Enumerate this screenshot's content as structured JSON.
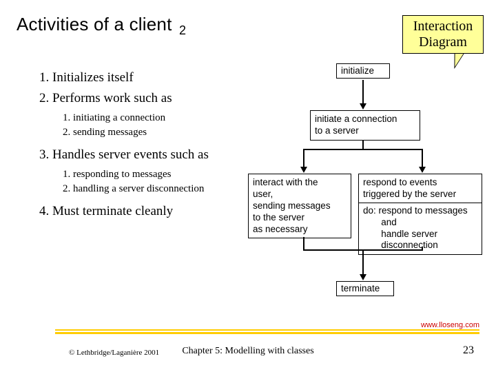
{
  "title": "Activities of a client",
  "title_sub": "2",
  "callout_l1": "Interaction",
  "callout_l2": "Diagram",
  "main": {
    "i1": "Initializes itself",
    "i2": "Performs work such as",
    "i3": "Handles server events such as",
    "i4": "Must terminate cleanly"
  },
  "sub_a": {
    "s1": "initiating a connection",
    "s2": "sending messages"
  },
  "sub_b": {
    "s1": "responding to messages",
    "s2": "handling a server disconnection"
  },
  "nodes": {
    "n1": "initialize",
    "n2_l1": "initiate a connection",
    "n2_l2": "to a server",
    "n3_l1": "interact with the",
    "n3_l2": "user,",
    "n3_l3": "sending messages",
    "n3_l4": "to the server",
    "n3_l5": "as necessary",
    "n4_l1": "respond to events",
    "n4_l2": "triggered by the server",
    "n4_l3": "do: respond to messages",
    "n4_l4": "       and",
    "n4_l5": "       handle server",
    "n4_l6": "       disconnection",
    "n5": "terminate"
  },
  "footer": {
    "url": "www.lloseng.com",
    "copy": "© Lethbridge/Laganière 2001",
    "chapter": "Chapter 5: Modelling with classes",
    "page": "23"
  }
}
